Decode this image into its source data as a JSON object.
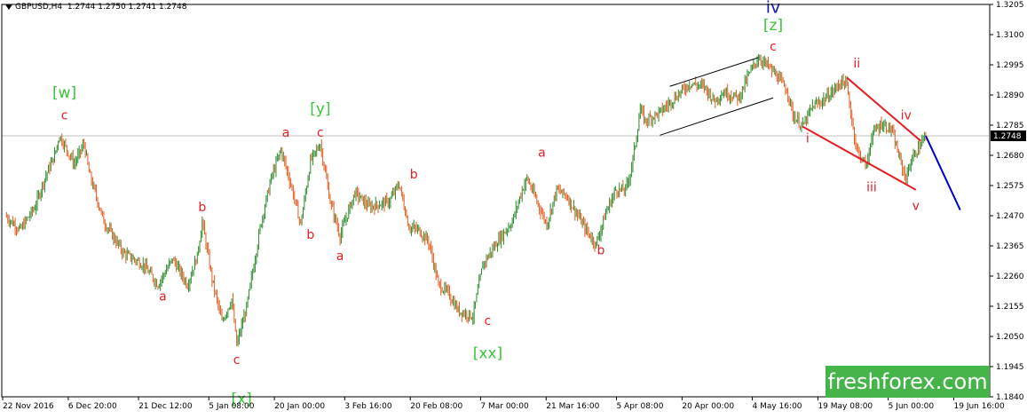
{
  "header": {
    "symbol": "GBPUSD,H4",
    "ohlc": "1.2744 1.2750 1.2741 1.2748"
  },
  "watermark": {
    "text": "freshforex.com",
    "color": "#45b54a"
  },
  "colors": {
    "bull": "#2e8b2e",
    "bear": "#e35d1f",
    "wave_red": "#e31e24",
    "wave_green": "#3cc43c",
    "wave_blue": "#1a1aaa",
    "channel": "#000000",
    "projection": "#0000cc",
    "price_line": "#c0c0c0"
  },
  "chart_data": {
    "type": "candlestick",
    "timeframe": "H4",
    "current_price": 1.2748,
    "current_price_label": "1.2748",
    "ylim": [
      1.184,
      1.3205
    ],
    "y_ticks": [
      "1.3205",
      "1.3100",
      "1.2995",
      "1.2890",
      "1.2785",
      "1.2680",
      "1.2575",
      "1.2470",
      "1.2365",
      "1.2260",
      "1.2155",
      "1.2050",
      "1.1945",
      "1.1840"
    ],
    "x_ticks": [
      "22 Nov 2016",
      "6 Dec 20:00",
      "21 Dec 12:00",
      "5 Jan 08:00",
      "20 Jan 00:00",
      "3 Feb 16:00",
      "20 Feb 08:00",
      "7 Mar 00:00",
      "21 Mar 16:00",
      "5 Apr 08:00",
      "20 Apr 00:00",
      "4 May 16:00",
      "19 May 08:00",
      "5 Jun 00:00",
      "19 Jun 16:00"
    ],
    "price_path": [
      [
        0,
        1.247
      ],
      [
        3,
        1.242
      ],
      [
        6,
        1.25
      ],
      [
        8,
        1.26
      ],
      [
        10,
        1.268
      ],
      [
        11,
        1.275
      ],
      [
        14,
        1.265
      ],
      [
        16,
        1.272
      ],
      [
        17,
        1.262
      ],
      [
        20,
        1.245
      ],
      [
        24,
        1.234
      ],
      [
        28,
        1.23
      ],
      [
        31,
        1.223
      ],
      [
        34,
        1.232
      ],
      [
        37,
        1.223
      ],
      [
        39,
        1.233
      ],
      [
        40,
        1.245
      ],
      [
        42,
        1.225
      ],
      [
        44,
        1.21
      ],
      [
        46,
        1.218
      ],
      [
        47,
        1.202
      ],
      [
        49,
        1.215
      ],
      [
        52,
        1.245
      ],
      [
        54,
        1.26
      ],
      [
        56,
        1.27
      ],
      [
        58,
        1.258
      ],
      [
        60,
        1.244
      ],
      [
        62,
        1.266
      ],
      [
        64,
        1.272
      ],
      [
        66,
        1.252
      ],
      [
        68,
        1.24
      ],
      [
        71,
        1.255
      ],
      [
        74,
        1.25
      ],
      [
        78,
        1.252
      ],
      [
        80,
        1.258
      ],
      [
        82,
        1.243
      ],
      [
        84,
        1.242
      ],
      [
        86,
        1.238
      ],
      [
        88,
        1.223
      ],
      [
        90,
        1.22
      ],
      [
        92,
        1.214
      ],
      [
        95,
        1.212
      ],
      [
        97,
        1.23
      ],
      [
        100,
        1.238
      ],
      [
        103,
        1.245
      ],
      [
        105,
        1.256
      ],
      [
        106,
        1.26
      ],
      [
        108,
        1.252
      ],
      [
        110,
        1.244
      ],
      [
        112,
        1.256
      ],
      [
        114,
        1.254
      ],
      [
        116,
        1.248
      ],
      [
        118,
        1.242
      ],
      [
        120,
        1.237
      ],
      [
        122,
        1.248
      ],
      [
        124,
        1.256
      ],
      [
        126,
        1.256
      ],
      [
        127,
        1.262
      ],
      [
        128,
        1.272
      ],
      [
        129,
        1.284
      ],
      [
        130,
        1.28
      ],
      [
        133,
        1.283
      ],
      [
        136,
        1.288
      ],
      [
        139,
        1.293
      ],
      [
        142,
        1.292
      ],
      [
        144,
        1.287
      ],
      [
        146,
        1.29
      ],
      [
        149,
        1.288
      ],
      [
        151,
        1.296
      ],
      [
        153,
        1.302
      ],
      [
        155,
        1.299
      ],
      [
        157,
        1.295
      ],
      [
        159,
        1.29
      ],
      [
        160,
        1.282
      ],
      [
        162,
        1.278
      ],
      [
        164,
        1.285
      ],
      [
        166,
        1.287
      ],
      [
        168,
        1.29
      ],
      [
        170,
        1.294
      ],
      [
        171,
        1.292
      ],
      [
        172,
        1.28
      ],
      [
        173,
        1.27
      ],
      [
        175,
        1.264
      ],
      [
        176,
        1.275
      ],
      [
        178,
        1.279
      ],
      [
        180,
        1.277
      ],
      [
        182,
        1.265
      ],
      [
        183,
        1.26
      ],
      [
        184,
        1.266
      ],
      [
        186,
        1.272
      ],
      [
        187,
        1.2748
      ]
    ],
    "projection": [
      [
        187,
        1.2748
      ],
      [
        194,
        1.249
      ]
    ],
    "wedge_lines": [
      [
        [
          171,
          1.295
        ],
        [
          186,
          1.273
        ]
      ],
      [
        [
          162,
          1.278
        ],
        [
          185,
          1.256
        ]
      ]
    ],
    "channel_lines": [
      [
        [
          135,
          1.292
        ],
        [
          153,
          1.302
        ]
      ],
      [
        [
          133,
          1.275
        ],
        [
          156,
          1.288
        ]
      ]
    ],
    "annotations": [
      {
        "text": "[w]",
        "x": 12,
        "y": 1.288,
        "color": "green"
      },
      {
        "text": "c",
        "x": 12,
        "y": 1.2805,
        "color": "red"
      },
      {
        "text": "b",
        "x": 40,
        "y": 1.2485,
        "color": "red"
      },
      {
        "text": "a",
        "x": 32,
        "y": 1.2175,
        "color": "red"
      },
      {
        "text": "c",
        "x": 47,
        "y": 1.1955,
        "color": "red"
      },
      {
        "text": "[x]",
        "x": 48,
        "y": 1.1815,
        "color": "green"
      },
      {
        "text": "a",
        "x": 57,
        "y": 1.2745,
        "color": "red"
      },
      {
        "text": "c",
        "x": 64,
        "y": 1.2745,
        "color": "red"
      },
      {
        "text": "[y]",
        "x": 64,
        "y": 1.2825,
        "color": "green"
      },
      {
        "text": "b",
        "x": 62,
        "y": 1.239,
        "color": "red"
      },
      {
        "text": "a",
        "x": 68,
        "y": 1.2315,
        "color": "red"
      },
      {
        "text": "b",
        "x": 83,
        "y": 1.26,
        "color": "red"
      },
      {
        "text": "c",
        "x": 98,
        "y": 1.209,
        "color": "red"
      },
      {
        "text": "[xx]",
        "x": 98,
        "y": 1.1975,
        "color": "green"
      },
      {
        "text": "a",
        "x": 109,
        "y": 1.2675,
        "color": "red"
      },
      {
        "text": "b",
        "x": 121,
        "y": 1.2335,
        "color": "red"
      },
      {
        "text": "iv",
        "x": 156,
        "y": 1.3175,
        "color": "blue"
      },
      {
        "text": "[z]",
        "x": 156,
        "y": 1.3115,
        "color": "green"
      },
      {
        "text": "c",
        "x": 156,
        "y": 1.3045,
        "color": "red"
      },
      {
        "text": "i",
        "x": 163,
        "y": 1.2725,
        "color": "red"
      },
      {
        "text": "ii",
        "x": 173,
        "y": 1.2985,
        "color": "red"
      },
      {
        "text": "iii",
        "x": 176,
        "y": 1.2555,
        "color": "red"
      },
      {
        "text": "iv",
        "x": 183,
        "y": 1.2805,
        "color": "red"
      },
      {
        "text": "v",
        "x": 185,
        "y": 1.249,
        "color": "red"
      }
    ]
  }
}
